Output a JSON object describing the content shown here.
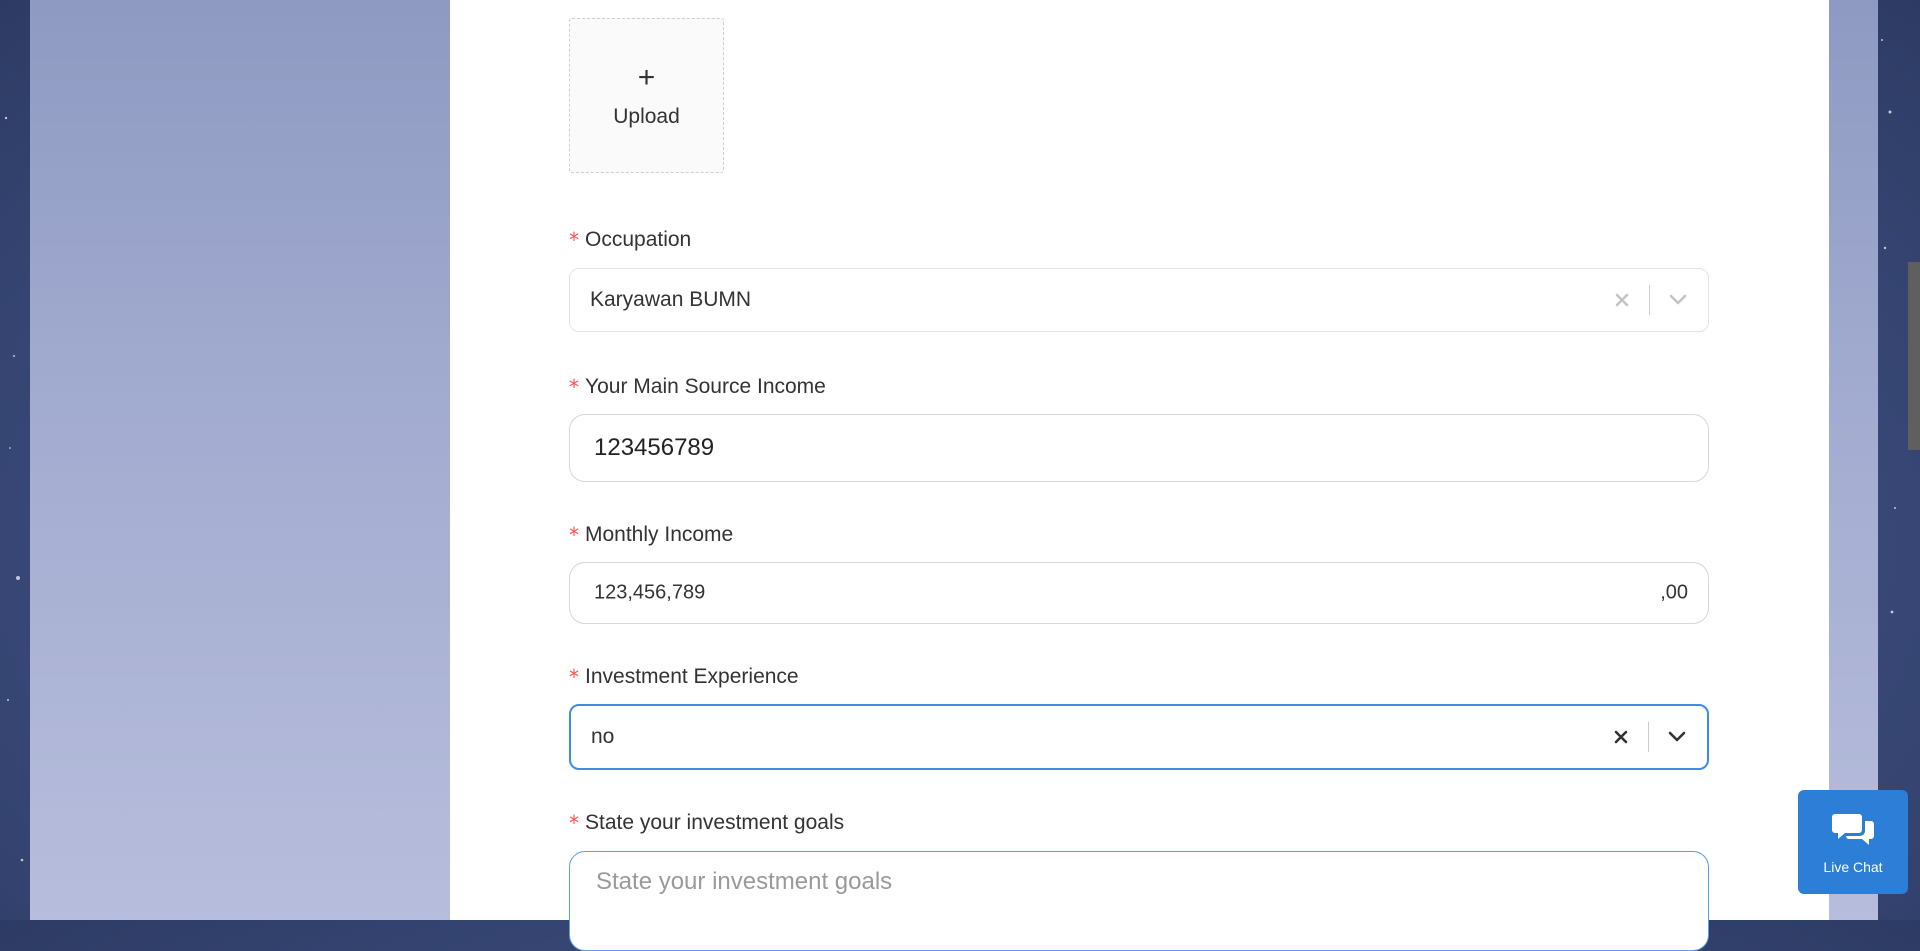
{
  "upload": {
    "plus": "+",
    "label": "Upload"
  },
  "occupation": {
    "label": "Occupation",
    "required_mark": "*",
    "value": "Karyawan BUMN"
  },
  "main_source_income": {
    "label": "Your Main Source Income",
    "required_mark": "*",
    "value": "123456789"
  },
  "monthly_income": {
    "label": "Monthly Income",
    "required_mark": "*",
    "value": "123,456,789",
    "suffix": ",00"
  },
  "investment_experience": {
    "label": "Investment Experience",
    "required_mark": "*",
    "value": "no"
  },
  "investment_goals": {
    "label": "State your investment goals",
    "required_mark": "*",
    "placeholder": "State your investment goals"
  },
  "live_chat": {
    "label": "Live Chat",
    "icon": "chat-bubbles-icon"
  },
  "colors": {
    "accent": "#2c7ed6",
    "focus_border": "#3d8ce6",
    "required": "#ff4d4f"
  }
}
